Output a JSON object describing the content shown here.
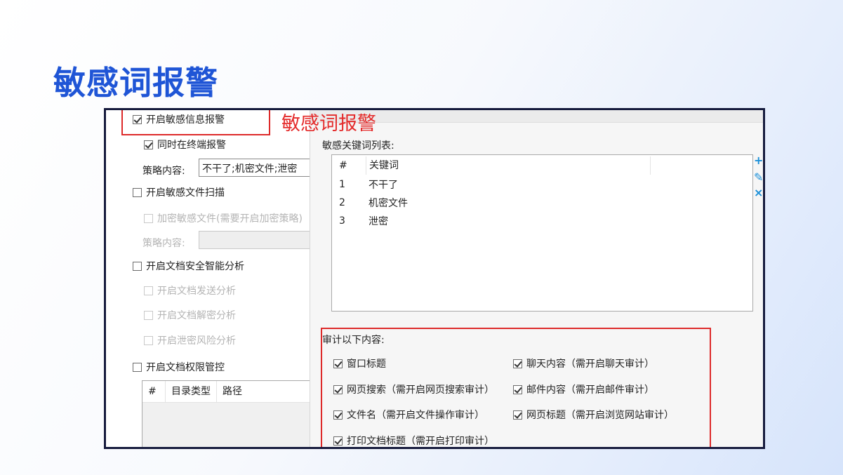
{
  "slide": {
    "title": "敏感词报警",
    "annotation": "敏感词报警"
  },
  "left_panel": {
    "enable_sensitive_alert": {
      "label": "开启敏感信息报警",
      "checked": true
    },
    "alert_at_terminal": {
      "label": "同时在终端报警",
      "checked": true
    },
    "policy_label_1": "策略内容:",
    "policy_value_1": "不干了;机密文件;泄密",
    "enable_file_scan": {
      "label": "开启敏感文件扫描",
      "checked": false
    },
    "encrypt_sensitive": {
      "label": "加密敏感文件(需要开启加密策略)",
      "checked": false
    },
    "policy_label_2": "策略内容:",
    "policy_value_2": "",
    "enable_doc_analysis": {
      "label": "开启文档安全智能分析",
      "checked": false
    },
    "doc_send_analysis": {
      "label": "开启文档发送分析",
      "checked": false
    },
    "doc_decrypt_analysis": {
      "label": "开启文档解密分析",
      "checked": false
    },
    "leak_risk_analysis": {
      "label": "开启泄密风险分析",
      "checked": false
    },
    "enable_permission_control": {
      "label": "开启文档权限管控",
      "checked": false
    },
    "dir_table": {
      "columns": [
        "#",
        "目录类型",
        "路径"
      ]
    }
  },
  "right_panel": {
    "topbar_text": "",
    "keyword_list_label": "敏感关键词列表:",
    "keyword_table": {
      "columns": [
        "#",
        "关键词"
      ],
      "rows": [
        {
          "num": "1",
          "keyword": "不干了"
        },
        {
          "num": "2",
          "keyword": "机密文件"
        },
        {
          "num": "3",
          "keyword": "泄密"
        }
      ]
    },
    "tools": {
      "add": "+",
      "edit": "✎",
      "remove": "×"
    },
    "audit_label": "审计以下内容:",
    "audit_items": [
      {
        "label": "窗口标题",
        "checked": true
      },
      {
        "label": "聊天内容（需开启聊天审计）",
        "checked": true
      },
      {
        "label": "网页搜索（需开启网页搜索审计）",
        "checked": true
      },
      {
        "label": "邮件内容（需开启邮件审计）",
        "checked": true
      },
      {
        "label": "文件名（需开启文件操作审计）",
        "checked": true
      },
      {
        "label": "网页标题（需开启浏览网站审计）",
        "checked": true
      },
      {
        "label": "打印文档标题（需开启打印审计）",
        "checked": true
      }
    ]
  },
  "colors": {
    "title": "#1f55d6",
    "highlight": "#dd2a2a",
    "frame": "#161b3d",
    "icon": "#1a8fd8"
  }
}
